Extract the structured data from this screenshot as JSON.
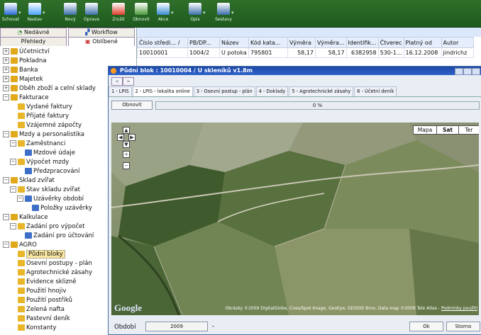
{
  "toolbar": {
    "buttons": [
      {
        "label": "Schovat",
        "icon": "hide-icon",
        "color": "#2b6bd6"
      },
      {
        "label": "Nastav",
        "icon": "settings-search-icon",
        "color": "#4aa3ff"
      },
      {
        "label": "Nový",
        "icon": "new-window-icon",
        "color": "#3a6ea8"
      },
      {
        "label": "Oprava",
        "icon": "edit-window-icon",
        "color": "#3a6ea8"
      },
      {
        "label": "Zrušit",
        "icon": "cancel-x-icon",
        "color": "#e03b2b"
      },
      {
        "label": "Obnovit",
        "icon": "refresh-doc-icon",
        "color": "#4c9a3a"
      },
      {
        "label": "Akce",
        "icon": "actions-icon",
        "color": "#3a8bd1"
      },
      {
        "label": "Opis",
        "icon": "print-icon",
        "color": "#3a6ea8"
      },
      {
        "label": "Sestavy",
        "icon": "reports-icon",
        "color": "#3a6ea8"
      }
    ]
  },
  "sidebar": {
    "tabs_top": [
      {
        "label": "Nedávné",
        "icon": "recent-icon"
      },
      {
        "label": "Workflow",
        "icon": "workflow-icon"
      }
    ],
    "tabs_bottom": [
      {
        "label": "Přehledy"
      },
      {
        "label": "Oblíbené",
        "icon": "favorites-icon"
      }
    ],
    "tree": [
      {
        "label": "Účetnictví",
        "level": 0,
        "exp": "+",
        "icon": "folder-db-icon",
        "selected": false
      },
      {
        "label": "Pokladna",
        "level": 0,
        "exp": "+",
        "icon": "folder-db-icon",
        "selected": false
      },
      {
        "label": "Banka",
        "level": 0,
        "exp": "+",
        "icon": "folder-db-icon",
        "selected": false
      },
      {
        "label": "Majetek",
        "level": 0,
        "exp": "+",
        "icon": "folder-db-icon",
        "selected": false
      },
      {
        "label": "Oběh zboží a celní sklady",
        "level": 0,
        "exp": "+",
        "icon": "folder-db-icon",
        "selected": false
      },
      {
        "label": "Fakturace",
        "level": 0,
        "exp": "−",
        "icon": "folder-db-icon",
        "selected": false
      },
      {
        "label": "Vydané faktury",
        "level": 1,
        "exp": "",
        "icon": "table-icon",
        "selected": false
      },
      {
        "label": "Přijaté faktury",
        "level": 1,
        "exp": "",
        "icon": "table-icon",
        "selected": false
      },
      {
        "label": "Vzájemné zápočty",
        "level": 1,
        "exp": "",
        "icon": "table-icon",
        "selected": false
      },
      {
        "label": "Mzdy a personalistika",
        "level": 0,
        "exp": "−",
        "icon": "folder-db-icon",
        "selected": false
      },
      {
        "label": "Zaměstnanci",
        "level": 1,
        "exp": "−",
        "icon": "table-icon",
        "selected": false
      },
      {
        "label": "Mzdové údaje",
        "level": 2,
        "exp": "",
        "icon": "subtable-icon",
        "selected": false
      },
      {
        "label": "Výpočet mzdy",
        "level": 1,
        "exp": "−",
        "icon": "table-icon",
        "selected": false
      },
      {
        "label": "Předzpracování",
        "level": 2,
        "exp": "",
        "icon": "subtable-icon",
        "selected": false
      },
      {
        "label": "Sklad zvířat",
        "level": 0,
        "exp": "−",
        "icon": "folder-db-icon",
        "selected": false
      },
      {
        "label": "Stav skladu zvířat",
        "level": 1,
        "exp": "−",
        "icon": "table-icon",
        "selected": false
      },
      {
        "label": "Uzávěrky období",
        "level": 2,
        "exp": "−",
        "icon": "subtable-icon",
        "selected": false
      },
      {
        "label": "Položky uzávěrky",
        "level": 3,
        "exp": "",
        "icon": "subtable-icon",
        "selected": false
      },
      {
        "label": "Kalkulace",
        "level": 0,
        "exp": "−",
        "icon": "folder-db-icon",
        "selected": false
      },
      {
        "label": "Zadání pro výpočet",
        "level": 1,
        "exp": "−",
        "icon": "table-icon",
        "selected": false
      },
      {
        "label": "Zadání pro účtování",
        "level": 2,
        "exp": "",
        "icon": "subtable-icon",
        "selected": false
      },
      {
        "label": "AGRO",
        "level": 0,
        "exp": "−",
        "icon": "folder-db-icon",
        "selected": false
      },
      {
        "label": "Půdní bloky",
        "level": 1,
        "exp": "",
        "icon": "table-icon",
        "selected": true
      },
      {
        "label": "Osevní postupy - plán",
        "level": 1,
        "exp": "",
        "icon": "table-icon",
        "selected": false
      },
      {
        "label": "Agrotechnické zásahy",
        "level": 1,
        "exp": "",
        "icon": "table-icon",
        "selected": false
      },
      {
        "label": "Evidence sklizně",
        "level": 1,
        "exp": "",
        "icon": "table-icon",
        "selected": false
      },
      {
        "label": "Použití hnojiv",
        "level": 1,
        "exp": "",
        "icon": "table-icon",
        "selected": false
      },
      {
        "label": "Použití postřiků",
        "level": 1,
        "exp": "",
        "icon": "table-icon",
        "selected": false
      },
      {
        "label": "Zelená nafta",
        "level": 1,
        "exp": "",
        "icon": "table-icon",
        "selected": false
      },
      {
        "label": "Pastevní deník",
        "level": 1,
        "exp": "",
        "icon": "table-icon",
        "selected": false
      },
      {
        "label": "Konstanty",
        "level": 1,
        "exp": "",
        "icon": "table-icon",
        "selected": false
      }
    ]
  },
  "grid": {
    "columns": [
      "Číslo středi...",
      "PB/DP...",
      "Název",
      "Kód kata...",
      "Výměra",
      "Výměra...",
      "Identifik...",
      "Čtverec",
      "Platný od",
      "Autor"
    ],
    "sort_marker": "/",
    "rows": [
      [
        "10010001",
        "1004/2",
        "U potoka",
        "795801",
        "58,17",
        "58,17",
        "6382958",
        "530-1...",
        "16.12.2008",
        "jindrichz"
      ]
    ]
  },
  "window": {
    "title": "Půdní blok : 10010004 / U skleníků v1.8m",
    "nav_prev": "<",
    "nav_next": ">",
    "tabs": [
      {
        "label": "1 - LPIS",
        "active": false
      },
      {
        "label": "2 - LPIS - lokalita online",
        "active": true
      },
      {
        "label": "3 - Osevní postup - plán",
        "active": false
      },
      {
        "label": "4 - Doklady",
        "active": false
      },
      {
        "label": "5 - Agrotechnické zásahy",
        "active": false
      },
      {
        "label": "6 - Účetní deník",
        "active": false
      }
    ],
    "refresh_label": "Obnovit",
    "progress_text": "0 %",
    "progress_fraction": 0,
    "map": {
      "types": [
        "Mapa",
        "Sat",
        "Ter"
      ],
      "active_type": "Sat",
      "logo": "Google",
      "attribution": "Obrázky ©2009 DigitalGlobe, Cnes/Spot Image, GeoEye, GEODIS Brno, Data map ©2009 Tele Atlas - ",
      "terms": "Podmínky použití"
    },
    "footer": {
      "period_label": "Období",
      "period_value": "2009",
      "dash": "-",
      "ok": "Ok",
      "cancel": "Storno"
    }
  }
}
